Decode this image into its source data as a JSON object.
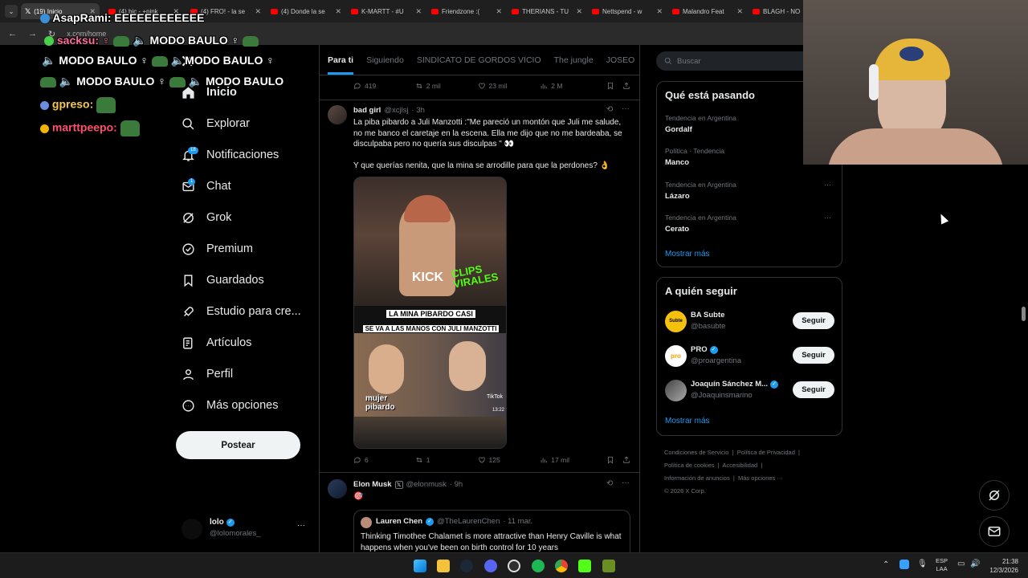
{
  "browser": {
    "tabs": [
      {
        "label": "(19) Inicio",
        "active": true
      },
      {
        "label": "(4) bic - +pink"
      },
      {
        "label": "(4) FRO! - la se"
      },
      {
        "label": "(4) Donde la se"
      },
      {
        "label": "K-MARTT - #U"
      },
      {
        "label": "Friendzone :("
      },
      {
        "label": "THERIANS - TU"
      },
      {
        "label": "Nettspend - w"
      },
      {
        "label": "Malandro Feat"
      },
      {
        "label": "BLAGH - NO"
      }
    ],
    "address": "x.com/home"
  },
  "chat_overlay": {
    "lines": [
      "AsapRami: EEEEEEEEEEEE",
      "sacksu: ♀",
      "MODO BAULO ♀",
      "MODO BAULO ♀",
      "MODO BAULO ♀",
      "MODO BAULO ♀",
      "MODO BAULO ♀",
      "MODO BAULO",
      "gpreso:",
      "marttpeepo:"
    ]
  },
  "nav": {
    "items": [
      {
        "label": "Inicio",
        "icon": "home-icon"
      },
      {
        "label": "Explorar",
        "icon": "search-icon"
      },
      {
        "label": "Notificaciones",
        "icon": "bell-icon",
        "badge": "18"
      },
      {
        "label": "Chat",
        "icon": "mail-icon",
        "badge": "1"
      },
      {
        "label": "Grok",
        "icon": "grok-icon"
      },
      {
        "label": "Premium",
        "icon": "premium-icon"
      },
      {
        "label": "Guardados",
        "icon": "bookmark-icon"
      },
      {
        "label": "Estudio para cre...",
        "icon": "rocket-icon"
      },
      {
        "label": "Artículos",
        "icon": "article-icon"
      },
      {
        "label": "Perfil",
        "icon": "person-icon"
      },
      {
        "label": "Más opciones",
        "icon": "more-circle-icon"
      }
    ],
    "post_label": "Postear",
    "account": {
      "name": "lolo",
      "handle": "@lolomorales_",
      "more": "···"
    }
  },
  "feed": {
    "tabs": [
      "Para ti",
      "Siguiendo",
      "SINDICATO DE GORDOS VICIO",
      "The jungle",
      "JOSEO"
    ],
    "top_actions": {
      "replies": "419",
      "reposts": "2 mil",
      "likes": "23 mil",
      "views": "2 M"
    },
    "post1": {
      "name": "bad girl",
      "handle": "@xcjlsj",
      "time": "· 3h",
      "text1": "La piba pibardo a Juli Manzotti :\"Me pareció un montón que Juli me salude, no me banco el caretaje en la escena. Ella me dijo que no me bardeaba, se disculpaba pero no quería sus disculpas \" 👀",
      "text2": "Y que querías nenita,  que la mina se arrodille para que la perdones? 👌",
      "media_kick": "KICK",
      "media_clips": "CLIPS VIRALES",
      "media_caption1": "LA MINA PIBARDO CASI",
      "media_caption2": "SE VA A LAS MANOS CON JULI MANZOTTI",
      "media_tag": "mujer pibardo",
      "media_tiktok": "TikTok",
      "media_time": "13:22",
      "replies": "6",
      "reposts": "1",
      "likes": "125",
      "views": "17 mil"
    },
    "post2": {
      "name": "Elon Musk",
      "handle": "@elonmusk",
      "time": "· 9h",
      "text": "🎯",
      "quote": {
        "name": "Lauren Chen",
        "handle": "@TheLaurenChen",
        "time": "· 11 mar.",
        "text": "Thinking Timothee Chalamet is more attractive than Henry Caville is what happens when you've been on birth control for 10 years"
      }
    }
  },
  "right": {
    "search_placeholder": "Buscar",
    "trends_title": "Qué está pasando",
    "trends": [
      {
        "meta": "Tendencia en Argentina",
        "name": "Gordalf"
      },
      {
        "meta": "Política · Tendencia",
        "name": "Manco"
      },
      {
        "meta": "Tendencia en Argentina",
        "name": "Lázaro"
      },
      {
        "meta": "Tendencia en Argentina",
        "name": "Cerato"
      }
    ],
    "show_more": "Mostrar más",
    "follow_title": "A quién seguir",
    "follow": [
      {
        "name": "BA Subte",
        "handle": "@basubte",
        "btn": "Seguir",
        "avatar_text": "Subte"
      },
      {
        "name": "PRO",
        "handle": "@proargentina",
        "btn": "Seguir",
        "avatar_text": "pro"
      },
      {
        "name": "Joaquín Sánchez M...",
        "handle": "@Joaquinsmarino",
        "btn": "Seguir",
        "avatar_text": ""
      }
    ],
    "show_more2": "Mostrar más",
    "footer": {
      "row1a": "Condiciones de Servicio",
      "row1b": "Política de Privacidad",
      "row2a": "Política de cookies",
      "row2b": "Accesibilidad",
      "row3a": "Información de anuncios",
      "row3b": "Más opciones ···",
      "copyright": "© 2026 X Corp."
    }
  },
  "taskbar": {
    "lang1": "ESP",
    "lang2": "LAA",
    "time": "21:38",
    "date": "12/3/2026"
  },
  "colors": {
    "accent": "#1d9bf0",
    "bg": "#000000",
    "border": "#2f3336"
  }
}
